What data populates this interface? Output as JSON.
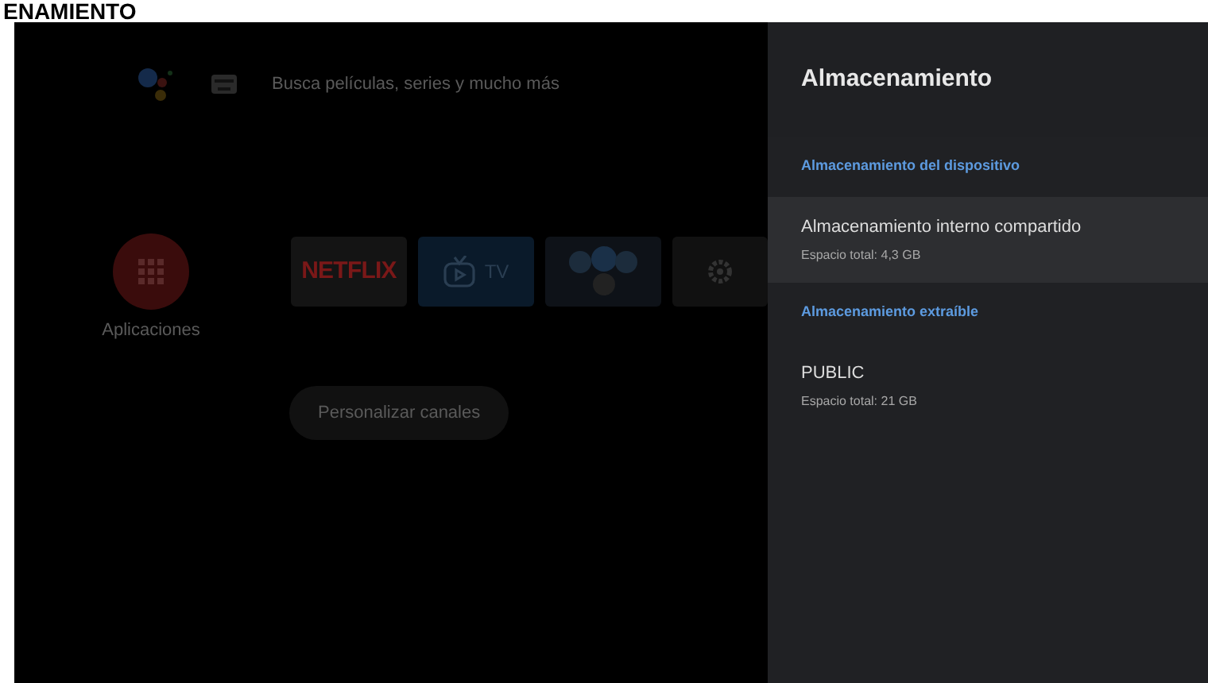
{
  "doc_heading": "ENAMIENTO",
  "home": {
    "search": {
      "placeholder": "Busca películas, series y mucho más"
    },
    "apps": {
      "label": "Aplicaciones"
    },
    "tiles": [
      {
        "kind": "netflix",
        "label": "NETFLIX"
      },
      {
        "kind": "tv",
        "label": "TV"
      },
      {
        "kind": "games"
      },
      {
        "kind": "settings"
      }
    ],
    "channels_button": "Personalizar canales"
  },
  "panel": {
    "title": "Almacenamiento",
    "sections": [
      {
        "header": "Almacenamiento del dispositivo",
        "items": [
          {
            "title": "Almacenamiento interno compartido",
            "subtitle": "Espacio total: 4,3 GB",
            "selected": true
          }
        ]
      },
      {
        "header": "Almacenamiento extraíble",
        "items": [
          {
            "title": "PUBLIC",
            "subtitle": "Espacio total: 21 GB",
            "selected": false
          }
        ]
      }
    ]
  }
}
